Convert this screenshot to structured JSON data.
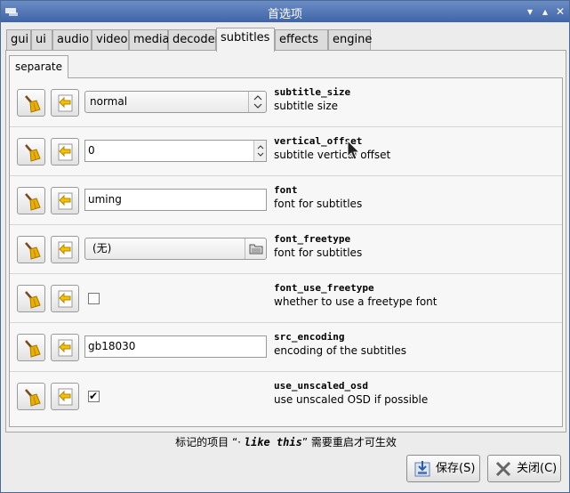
{
  "window": {
    "title": "首选项"
  },
  "tabs": [
    {
      "label": "gui"
    },
    {
      "label": "ui"
    },
    {
      "label": "audio"
    },
    {
      "label": "video"
    },
    {
      "label": "media"
    },
    {
      "label": "decoder"
    },
    {
      "label": "subtitles"
    },
    {
      "label": "effects"
    },
    {
      "label": "engine"
    }
  ],
  "active_tab": "subtitles",
  "subtab": {
    "label": "separate"
  },
  "options": {
    "subtitle_size": {
      "name": "subtitle_size",
      "description": "subtitle size",
      "value": "normal"
    },
    "vertical_offset": {
      "name": "vertical_offset",
      "description": "subtitle vertical offset",
      "value": "0"
    },
    "font": {
      "name": "font",
      "description": "font for subtitles",
      "value": "uming"
    },
    "font_freetype": {
      "name": "font_freetype",
      "description": "font for subtitles",
      "value": "(无)"
    },
    "font_use_freetype": {
      "name": "font_use_freetype",
      "description": "whether to use a freetype font",
      "checked": false
    },
    "src_encoding": {
      "name": "src_encoding",
      "description": "encoding of the subtitles",
      "value": "gb18030"
    },
    "use_unscaled_osd": {
      "name": "use_unscaled_osd",
      "description": "use unscaled OSD if possible",
      "checked": true
    }
  },
  "footer": {
    "note_before": "标记的项目 “· ",
    "note_emph": "like this",
    "note_after": "” 需要重启才可生效"
  },
  "buttons": {
    "save": "保存(S)",
    "close": "关闭(C)"
  },
  "colors": {
    "titlebar": "#4a6fb0",
    "broom": "#e9b000",
    "revert_arrow": "#d8a000"
  },
  "icons": {
    "clear": "broom-icon",
    "revert": "revert-arrow-icon"
  }
}
